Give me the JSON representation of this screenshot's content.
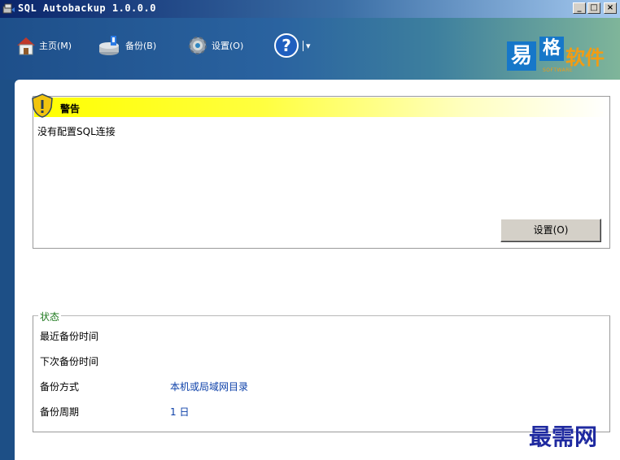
{
  "window": {
    "title": "SQL Autobackup 1.0.0.0",
    "controls": {
      "minimize": "_",
      "maximize": "□",
      "close": "×"
    }
  },
  "toolbar": {
    "items": [
      {
        "label": "主页(M)",
        "icon": "home-icon"
      },
      {
        "label": "备份(B)",
        "icon": "backup-icon"
      },
      {
        "label": "设置(O)",
        "icon": "gear-icon"
      },
      {
        "label": "",
        "icon": "help-icon"
      }
    ],
    "dropdown_glyph": "▾",
    "logo": {
      "char1": "易",
      "char2": "格",
      "brand": "软件",
      "sub": "SOFTWARE"
    }
  },
  "warning": {
    "title": "警告",
    "message": "没有配置SQL连接",
    "button": "设置(O)"
  },
  "status": {
    "legend": "状态",
    "rows": [
      {
        "label": "最近备份时间",
        "value": ""
      },
      {
        "label": "下次备份时间",
        "value": ""
      },
      {
        "label": "备份方式",
        "value": "本机或局域网目录"
      },
      {
        "label": "备份周期",
        "value": "1 日"
      }
    ]
  },
  "watermark": "最需网",
  "colors": {
    "accent": "#1d4f86",
    "warning_bar": "#ffff00",
    "value_text": "#0b3fa8",
    "legend": "#1f7a1f",
    "logo_orange": "#f39c12",
    "logo_blue": "#1677c9"
  }
}
